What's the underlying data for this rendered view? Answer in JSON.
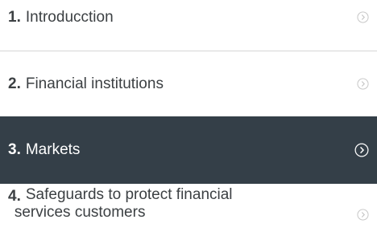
{
  "menu": {
    "items": [
      {
        "number": "1.",
        "label": "Introducction",
        "active": false
      },
      {
        "number": "2.",
        "label": "Financial institutions",
        "active": false
      },
      {
        "number": "3.",
        "label": "Markets",
        "active": true
      },
      {
        "number": "4.",
        "label_line1": "Safeguards to protect financial",
        "label_line2": "services customers",
        "active": false
      }
    ],
    "chevron_icon": "chevron-right-circle-icon",
    "colors": {
      "text": "#3c4043",
      "active_bg": "#343f48",
      "active_text": "#ffffff",
      "divider": "#d6d6d6",
      "chevron": "#c4c4c4"
    }
  }
}
